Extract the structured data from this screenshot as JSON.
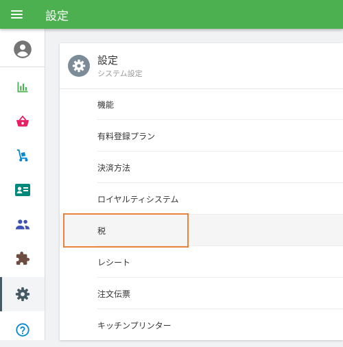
{
  "header": {
    "title": "設定"
  },
  "sidebar": {
    "items": [
      {
        "icon": "account-circle-icon",
        "color": "#757575"
      },
      {
        "icon": "bar-chart-icon",
        "color": "#4caf50"
      },
      {
        "icon": "shopping-basket-icon",
        "color": "#e91e63"
      },
      {
        "icon": "hand-truck-icon",
        "color": "#0288d1"
      },
      {
        "icon": "id-card-icon",
        "color": "#00897b"
      },
      {
        "icon": "people-icon",
        "color": "#3f51b5"
      },
      {
        "icon": "puzzle-piece-icon",
        "color": "#6d4c41"
      },
      {
        "icon": "gear-icon",
        "color": "#455a64",
        "active": true
      },
      {
        "icon": "help-circle-icon",
        "color": "#0288d1"
      }
    ]
  },
  "card": {
    "icon": "gear-icon",
    "title": "設定",
    "subtitle": "システム設定",
    "items": [
      {
        "label": "機能"
      },
      {
        "label": "有料登録プラン"
      },
      {
        "label": "決済方法"
      },
      {
        "label": "ロイヤルティシステム"
      },
      {
        "label": "税",
        "highlighted": true
      },
      {
        "label": "レシート"
      },
      {
        "label": "注文伝票"
      },
      {
        "label": "キッチンプリンター"
      }
    ]
  },
  "colors": {
    "app_bar": "#4caf50",
    "focus_outline": "#e8833a"
  }
}
